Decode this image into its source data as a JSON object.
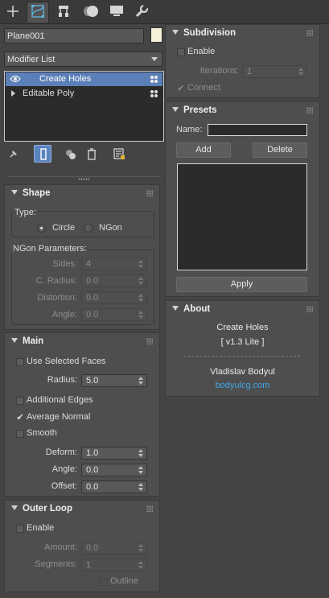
{
  "tabs": [
    {
      "icon": "plus-icon"
    },
    {
      "icon": "modify-icon"
    },
    {
      "icon": "hierarchy-icon"
    },
    {
      "icon": "motion-icon"
    },
    {
      "icon": "display-icon"
    },
    {
      "icon": "utilities-icon"
    }
  ],
  "object_name": "Plane001",
  "object_color": "#f5f1d8",
  "modifier_list": "Modifier List",
  "stack": [
    {
      "label": "Create Holes",
      "selected": true
    },
    {
      "label": "Editable Poly",
      "selected": false
    }
  ],
  "shape": {
    "title": "Shape",
    "type_label": "Type:",
    "circle": "Circle",
    "ngon": "NGon",
    "ngon_params": "NGon Parameters:",
    "sides_label": "Sides:",
    "sides": "4",
    "cradius_label": "C. Radius:",
    "cradius": "0.0",
    "distortion_label": "Distortion:",
    "distortion": "0.0",
    "angle_label": "Angle:",
    "angle": "0.0"
  },
  "main": {
    "title": "Main",
    "use_selected": "Use Selected Faces",
    "radius_label": "Radius:",
    "radius": "5.0",
    "additional_edges": "Additional Edges",
    "average_normal": "Average Normal",
    "smooth": "Smooth",
    "deform_label": "Deform:",
    "deform": "1.0",
    "angle_label": "Angle:",
    "angle": "0.0",
    "offset_label": "Offset:",
    "offset": "0.0"
  },
  "outer_loop": {
    "title": "Outer Loop",
    "enable": "Enable",
    "amount_label": "Amount:",
    "amount": "0.0",
    "segments_label": "Segments:",
    "segments": "1",
    "outline": "Outline"
  },
  "subdivision": {
    "title": "Subdivision",
    "enable": "Enable",
    "iterations_label": "Iterations:",
    "iterations": "1",
    "connect": "Connect"
  },
  "presets": {
    "title": "Presets",
    "name_label": "Name:",
    "name_value": "",
    "add": "Add",
    "delete": "Delete",
    "apply": "Apply"
  },
  "about": {
    "title": "About",
    "product": "Create Holes",
    "version": "[ v1.3 Lite ]",
    "author": "Vladislav Bodyul",
    "site": "bodyulcg.com",
    "link_color": "#3ea6e8"
  }
}
